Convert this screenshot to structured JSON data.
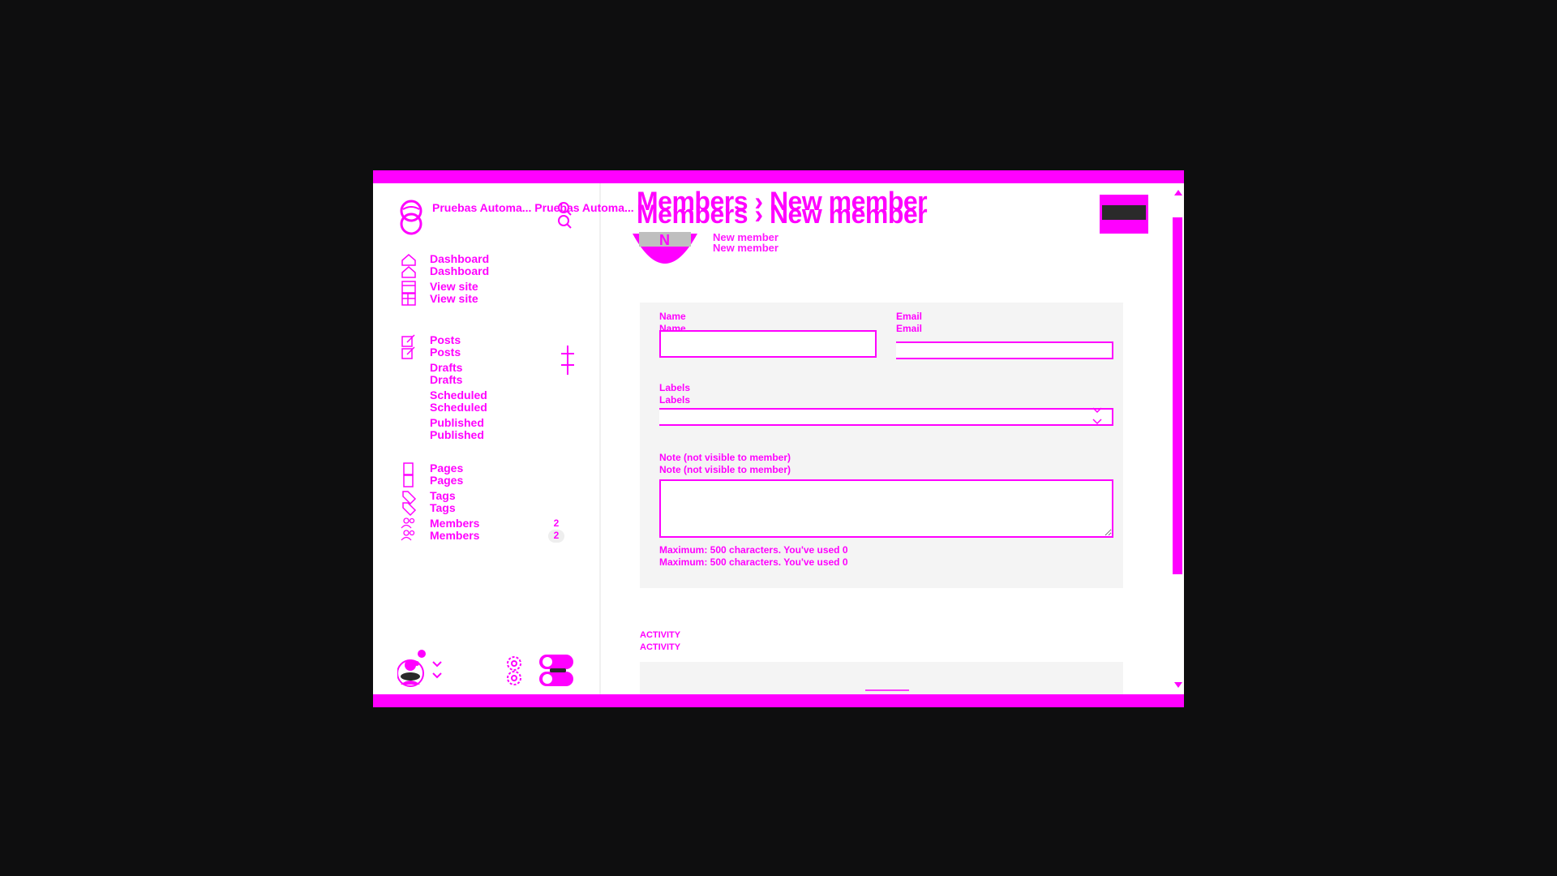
{
  "colors": {
    "accent": "#ff00ff",
    "backdrop": "#0e0e0f",
    "card": "#f4f4f4"
  },
  "brand": {
    "title": "Pruebas Automa...",
    "logo_icon": "ghost-logo-icon"
  },
  "nav": {
    "dashboard": "Dashboard",
    "view_site": "View site",
    "posts": "Posts",
    "drafts": "Drafts",
    "scheduled": "Scheduled",
    "published": "Published",
    "pages": "Pages",
    "tags": "Tags",
    "members": "Members",
    "members_count": "2"
  },
  "header": {
    "section": "Members",
    "page": "New member"
  },
  "member": {
    "initial": "N",
    "name": "New member"
  },
  "form": {
    "name_label": "Name",
    "name_value": "",
    "email_label": "Email",
    "email_value": "",
    "labels_label": "Labels",
    "note_label": "Note (not visible to member)",
    "note_value": "",
    "hint": "Maximum: 500 characters. You've used 0"
  },
  "activity": {
    "title": "ACTIVITY"
  }
}
